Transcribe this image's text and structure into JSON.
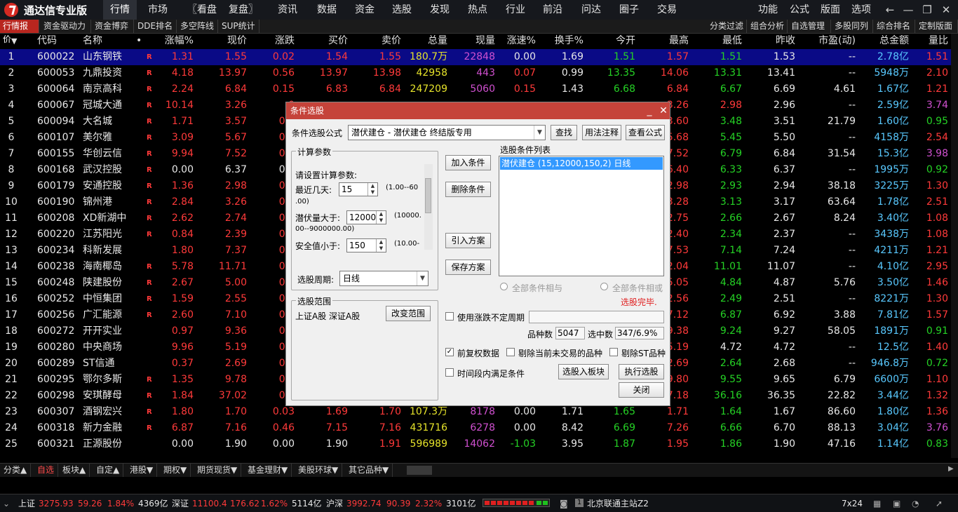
{
  "app": {
    "title": "通达信专业版"
  },
  "menu": [
    "行情",
    "市场",
    "〖看盘",
    "复盘〗",
    "资讯",
    "数据",
    "资金",
    "选股",
    "发现",
    "热点",
    "行业",
    "前沿",
    "问达",
    "圈子",
    "交易"
  ],
  "right_menu": [
    "功能",
    "公式",
    "版面",
    "选项"
  ],
  "tabs": [
    "行情报价",
    "资金驱动力",
    "资金博弈",
    "DDE排名",
    "多空阵线",
    "SUP统计"
  ],
  "right_tabs": [
    "分类过滤",
    "组合分析",
    "自选管理",
    "多股同列",
    "综合排名",
    "定制版面"
  ],
  "columns": [
    "代码",
    "名称",
    "•",
    "涨幅%",
    "现价",
    "涨跌",
    "买价",
    "卖价",
    "总量",
    "现量",
    "涨速%",
    "换手%",
    "今开",
    "最高",
    "最低",
    "昨收",
    "市盈(动)",
    "总金额",
    "量比"
  ],
  "col_sort_icon": "▼",
  "col_more": "?",
  "rows": [
    {
      "n": "1",
      "code": "600022",
      "name": "山东钢铁",
      "f": "R",
      "chg": "1.31",
      "price": "1.55",
      "diff": "0.02",
      "bid": "1.54",
      "ask": "1.55",
      "vol": "180.7万",
      "cur": "22848",
      "spd": "0.00",
      "turn": "1.69",
      "open": "1.51",
      "high": "1.57",
      "low": "1.51",
      "prev": "1.53",
      "pe": "--",
      "amt": "2.78亿",
      "vr": "1.51"
    },
    {
      "n": "2",
      "code": "600053",
      "name": "九鼎投资",
      "f": "R",
      "chg": "4.18",
      "price": "13.97",
      "diff": "0.56",
      "bid": "13.97",
      "ask": "13.98",
      "vol": "42958",
      "cur": "443",
      "spd": "0.07",
      "turn": "0.99",
      "open": "13.35",
      "high": "14.06",
      "low": "13.31",
      "prev": "13.41",
      "pe": "--",
      "amt": "5948万",
      "vr": "2.10"
    },
    {
      "n": "3",
      "code": "600064",
      "name": "南京高科",
      "f": "R",
      "chg": "2.24",
      "price": "6.84",
      "diff": "0.15",
      "bid": "6.83",
      "ask": "6.84",
      "vol": "247209",
      "cur": "5060",
      "spd": "0.15",
      "turn": "1.43",
      "open": "6.68",
      "high": "6.84",
      "low": "6.67",
      "prev": "6.69",
      "pe": "4.61",
      "amt": "1.67亿",
      "vr": "1.21"
    },
    {
      "n": "4",
      "code": "600067",
      "name": "冠城大通",
      "f": "R",
      "chg": "10.14",
      "price": "3.26",
      "diff": "0",
      "bid": "",
      "ask": "",
      "vol": "",
      "cur": "",
      "spd": "",
      "turn": "",
      "open": "",
      "high": "3.26",
      "low": "2.98",
      "prev": "2.96",
      "pe": "--",
      "amt": "2.59亿",
      "vr": "3.74"
    },
    {
      "n": "5",
      "code": "600094",
      "name": "大名城",
      "f": "R",
      "chg": "1.71",
      "price": "3.57",
      "diff": "0.0",
      "bid": "",
      "ask": "",
      "vol": "",
      "cur": "",
      "spd": "",
      "turn": "",
      "open": "",
      "high": "3.60",
      "low": "3.48",
      "prev": "3.51",
      "pe": "21.79",
      "amt": "1.60亿",
      "vr": "0.95"
    },
    {
      "n": "6",
      "code": "600107",
      "name": "美尔雅",
      "f": "R",
      "chg": "3.09",
      "price": "5.67",
      "diff": "0.1",
      "bid": "",
      "ask": "",
      "vol": "",
      "cur": "",
      "spd": "",
      "turn": "",
      "open": "",
      "high": "5.68",
      "low": "5.45",
      "prev": "5.50",
      "pe": "--",
      "amt": "4158万",
      "vr": "2.54"
    },
    {
      "n": "7",
      "code": "600155",
      "name": "华创云信",
      "f": "R",
      "chg": "9.94",
      "price": "7.52",
      "diff": "0.6",
      "bid": "",
      "ask": "",
      "vol": "",
      "cur": "",
      "spd": "",
      "turn": "",
      "open": "",
      "high": "7.52",
      "low": "6.79",
      "prev": "6.84",
      "pe": "31.54",
      "amt": "15.3亿",
      "vr": "3.98"
    },
    {
      "n": "8",
      "code": "600168",
      "name": "武汉控股",
      "f": "R",
      "chg": "0.00",
      "price": "6.37",
      "diff": "0.0",
      "bid": "",
      "ask": "",
      "vol": "",
      "cur": "",
      "spd": "",
      "turn": "",
      "open": "",
      "high": "6.40",
      "low": "6.33",
      "prev": "6.37",
      "pe": "--",
      "amt": "1995万",
      "vr": "0.92"
    },
    {
      "n": "9",
      "code": "600179",
      "name": "安通控股",
      "f": "R",
      "chg": "1.36",
      "price": "2.98",
      "diff": "0.0",
      "bid": "",
      "ask": "",
      "vol": "",
      "cur": "",
      "spd": "",
      "turn": "",
      "open": "",
      "high": "2.98",
      "low": "2.93",
      "prev": "2.94",
      "pe": "38.18",
      "amt": "3225万",
      "vr": "1.30"
    },
    {
      "n": "10",
      "code": "600190",
      "name": "锦州港",
      "f": "R",
      "chg": "2.84",
      "price": "3.26",
      "diff": "0.0",
      "bid": "",
      "ask": "",
      "vol": "",
      "cur": "",
      "spd": "",
      "turn": "",
      "open": "",
      "high": "3.28",
      "low": "3.13",
      "prev": "3.17",
      "pe": "63.64",
      "amt": "1.78亿",
      "vr": "2.51"
    },
    {
      "n": "11",
      "code": "600208",
      "name": "XD新湖中",
      "f": "R",
      "chg": "2.62",
      "price": "2.74",
      "diff": "0.0",
      "bid": "",
      "ask": "",
      "vol": "",
      "cur": "",
      "spd": "",
      "turn": "",
      "open": "",
      "high": "2.75",
      "low": "2.66",
      "prev": "2.67",
      "pe": "8.24",
      "amt": "3.40亿",
      "vr": "1.08"
    },
    {
      "n": "12",
      "code": "600220",
      "name": "江苏阳光",
      "f": "R",
      "chg": "0.84",
      "price": "2.39",
      "diff": "0.0",
      "bid": "",
      "ask": "",
      "vol": "",
      "cur": "",
      "spd": "",
      "turn": "",
      "open": "",
      "high": "2.40",
      "low": "2.34",
      "prev": "2.37",
      "pe": "--",
      "amt": "3438万",
      "vr": "1.08"
    },
    {
      "n": "13",
      "code": "600234",
      "name": "科新发展",
      "f": "",
      "chg": "1.80",
      "price": "7.37",
      "diff": "0.1",
      "bid": "",
      "ask": "",
      "vol": "",
      "cur": "",
      "spd": "",
      "turn": "",
      "open": "",
      "high": "7.53",
      "low": "7.14",
      "prev": "7.24",
      "pe": "--",
      "amt": "4211万",
      "vr": "1.21"
    },
    {
      "n": "14",
      "code": "600238",
      "name": "海南椰岛",
      "f": "R",
      "chg": "5.78",
      "price": "11.71",
      "diff": "0.6",
      "bid": "",
      "ask": "",
      "vol": "",
      "cur": "",
      "spd": "",
      "turn": "",
      "open": "",
      "high": "12.04",
      "low": "11.01",
      "prev": "11.07",
      "pe": "--",
      "amt": "4.10亿",
      "vr": "2.95"
    },
    {
      "n": "15",
      "code": "600248",
      "name": "陕建股份",
      "f": "R",
      "chg": "2.67",
      "price": "5.00",
      "diff": "0.1",
      "bid": "",
      "ask": "",
      "vol": "",
      "cur": "",
      "spd": "",
      "turn": "",
      "open": "",
      "high": "5.05",
      "low": "4.84",
      "prev": "4.87",
      "pe": "5.76",
      "amt": "3.50亿",
      "vr": "1.46"
    },
    {
      "n": "16",
      "code": "600252",
      "name": "中恒集团",
      "f": "R",
      "chg": "1.59",
      "price": "2.55",
      "diff": "0.0",
      "bid": "",
      "ask": "",
      "vol": "",
      "cur": "",
      "spd": "",
      "turn": "",
      "open": "",
      "high": "2.56",
      "low": "2.49",
      "prev": "2.51",
      "pe": "--",
      "amt": "8221万",
      "vr": "1.30"
    },
    {
      "n": "17",
      "code": "600256",
      "name": "广汇能源",
      "f": "R",
      "chg": "2.60",
      "price": "7.10",
      "diff": "0.1",
      "bid": "",
      "ask": "",
      "vol": "",
      "cur": "",
      "spd": "",
      "turn": "",
      "open": "",
      "high": "7.12",
      "low": "6.87",
      "prev": "6.92",
      "pe": "3.88",
      "amt": "7.81亿",
      "vr": "1.57"
    },
    {
      "n": "18",
      "code": "600272",
      "name": "开开实业",
      "f": "",
      "chg": "0.97",
      "price": "9.36",
      "diff": "0.0",
      "bid": "",
      "ask": "",
      "vol": "",
      "cur": "",
      "spd": "",
      "turn": "",
      "open": "",
      "high": "9.38",
      "low": "9.24",
      "prev": "9.27",
      "pe": "58.05",
      "amt": "1891万",
      "vr": "0.91"
    },
    {
      "n": "19",
      "code": "600280",
      "name": "中央商场",
      "f": "",
      "chg": "9.96",
      "price": "5.19",
      "diff": "0.4",
      "bid": "",
      "ask": "",
      "vol": "",
      "cur": "",
      "spd": "",
      "turn": "",
      "open": "",
      "high": "5.19",
      "low": "4.72",
      "prev": "4.72",
      "pe": "--",
      "amt": "12.5亿",
      "vr": "1.40"
    },
    {
      "n": "20",
      "code": "600289",
      "name": "ST信通",
      "f": "",
      "chg": "0.37",
      "price": "2.69",
      "diff": "0.0",
      "bid": "",
      "ask": "",
      "vol": "",
      "cur": "",
      "spd": "",
      "turn": "",
      "open": "",
      "high": "2.69",
      "low": "2.64",
      "prev": "2.68",
      "pe": "--",
      "amt": "946.8万",
      "vr": "0.72"
    },
    {
      "n": "21",
      "code": "600295",
      "name": "鄂尔多斯",
      "f": "R",
      "chg": "1.35",
      "price": "9.78",
      "diff": "0.1",
      "bid": "",
      "ask": "",
      "vol": "",
      "cur": "",
      "spd": "",
      "turn": "",
      "open": "",
      "high": "9.80",
      "low": "9.55",
      "prev": "9.65",
      "pe": "6.79",
      "amt": "6600万",
      "vr": "1.10"
    },
    {
      "n": "22",
      "code": "600298",
      "name": "安琪酵母",
      "f": "R",
      "chg": "1.84",
      "price": "37.02",
      "diff": "0.6",
      "bid": "",
      "ask": "",
      "vol": "",
      "cur": "",
      "spd": "",
      "turn": "",
      "open": "",
      "high": "37.18",
      "low": "36.16",
      "prev": "36.35",
      "pe": "22.82",
      "amt": "3.44亿",
      "vr": "1.32"
    },
    {
      "n": "23",
      "code": "600307",
      "name": "酒钢宏兴",
      "f": "R",
      "chg": "1.80",
      "price": "1.70",
      "diff": "0.03",
      "bid": "1.69",
      "ask": "1.70",
      "vol": "107.3万",
      "cur": "8178",
      "spd": "0.00",
      "turn": "1.71",
      "open": "1.65",
      "high": "1.71",
      "low": "1.64",
      "prev": "1.67",
      "pe": "86.60",
      "amt": "1.80亿",
      "vr": "1.36"
    },
    {
      "n": "24",
      "code": "600318",
      "name": "新力金融",
      "f": "R",
      "chg": "6.87",
      "price": "7.16",
      "diff": "0.46",
      "bid": "7.15",
      "ask": "7.16",
      "vol": "431716",
      "cur": "6278",
      "spd": "0.00",
      "turn": "8.42",
      "open": "6.69",
      "high": "7.26",
      "low": "6.66",
      "prev": "6.70",
      "pe": "88.13",
      "amt": "3.04亿",
      "vr": "3.76"
    },
    {
      "n": "25",
      "code": "600321",
      "name": "正源股份",
      "f": "",
      "chg": "0.00",
      "price": "1.90",
      "diff": "0.00",
      "bid": "1.90",
      "ask": "1.91",
      "vol": "596989",
      "cur": "14062",
      "spd": "-1.03",
      "turn": "3.95",
      "open": "1.87",
      "high": "1.95",
      "low": "1.86",
      "prev": "1.90",
      "pe": "47.16",
      "amt": "1.14亿",
      "vr": "0.83"
    }
  ],
  "dialog": {
    "title": "条件选股",
    "formula_label": "条件选股公式",
    "formula_value": "潜伏建仓    - 潜伏建仓 终结版专用",
    "btn_find": "查找",
    "btn_usage": "用法注释",
    "btn_view": "查看公式",
    "params_group": "计算参数",
    "params_prompt": "请设置计算参数:",
    "p1_label": "最近几天:",
    "p1_value": "15",
    "p1_range": "(1.00--60",
    "p1_range2": ".00)",
    "p2_label": "潜伏量大于:",
    "p2_value": "12000",
    "p2_range": "(10000.",
    "p2_range2": "00--9000000.00)",
    "p3_label": "安全值小于:",
    "p3_value": "150",
    "p3_range": "(10.00-",
    "period_label": "选股周期:",
    "period_value": "日线",
    "btn_add": "加入条件",
    "btn_delete": "删除条件",
    "btn_import": "引入方案",
    "btn_save": "保存方案",
    "list_label": "选股条件列表",
    "list_items": [
      "潜伏建仓 (15,12000,150,2) 日线"
    ],
    "radio_and": "全部条件相与",
    "radio_or": "全部条件相或",
    "done": "选股完毕.",
    "scope_group": "选股范围",
    "scope_value": "上证A股 深证A股",
    "btn_scope": "改变范围",
    "chk_uncertain": "使用涨跌不定周期",
    "count_label": "品种数",
    "count_value": "5047",
    "hit_label": "选中数",
    "hit_value": "347/6.9%",
    "chk_fq": "前复权数据",
    "chk_notrade": "剔除当前未交易的品种",
    "chk_st": "剔除ST品种",
    "chk_timeseg": "时间段内满足条件",
    "btn_toboard": "选股入板块",
    "btn_exec": "执行选股",
    "btn_close": "关闭"
  },
  "bottom_tabs": [
    "分类▲",
    "自选",
    "板块▲",
    "自定▲",
    "港股▼",
    "期权▼",
    "期货现货▼",
    "基金理财▼",
    "美股环球▼",
    "其它品种▼"
  ],
  "status": {
    "sh_label": "上证",
    "sh_val": "3275.93",
    "sh_chg": "59.26",
    "sh_pct": "1.84%",
    "sh_amt": "4369亿",
    "sz_label": "深证",
    "sz_val": "11100.4",
    "sz_chg": "176.62",
    "sz_pct": "1.62%",
    "sz_amt": "5114亿",
    "hs_label": "沪深",
    "hs_val": "3992.74",
    "hs_chg": "90.39",
    "hs_pct": "2.32%",
    "hs_amt": "3101亿",
    "server_num": "1",
    "server": "北京联通主站Z2",
    "clock": "7x24"
  }
}
